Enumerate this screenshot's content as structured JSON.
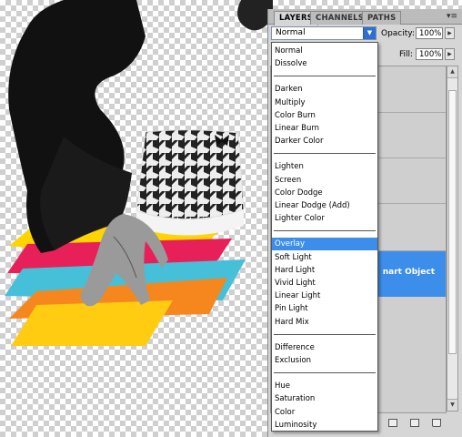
{
  "panel": {
    "tabs": [
      "LAYERS",
      "CHANNELS",
      "PATHS"
    ],
    "menu_glyph": "▾≡",
    "blend_mode": "Normal",
    "opacity_label": "Opacity:",
    "opacity_value": "100%",
    "fill_label": "Fill:",
    "fill_value": "100%",
    "smart_object_text": "nart Object"
  },
  "blend_menu": {
    "groups": [
      [
        "Normal",
        "Dissolve"
      ],
      [
        "Darken",
        "Multiply",
        "Color Burn",
        "Linear Burn",
        "Darker Color"
      ],
      [
        "Lighten",
        "Screen",
        "Color Dodge",
        "Linear Dodge (Add)",
        "Lighter Color"
      ],
      [
        "Overlay",
        "Soft Light",
        "Hard Light",
        "Vivid Light",
        "Linear Light",
        "Pin Light",
        "Hard Mix"
      ],
      [
        "Difference",
        "Exclusion"
      ],
      [
        "Hue",
        "Saturation",
        "Color",
        "Luminosity"
      ]
    ],
    "selected": "Overlay"
  },
  "icons": {
    "dropdown": "chevron-down-icon",
    "panel_menu": "panel-menu-icon",
    "bottom": [
      "new-group-icon",
      "new-layer-icon",
      "trash-icon"
    ]
  },
  "colors": {
    "selection": "#3d8eea",
    "panel_bg": "#d6d6d6",
    "yellow": "#ffd400",
    "magenta": "#e8205a",
    "cyan": "#45c0d8",
    "orange": "#f59a1e"
  }
}
